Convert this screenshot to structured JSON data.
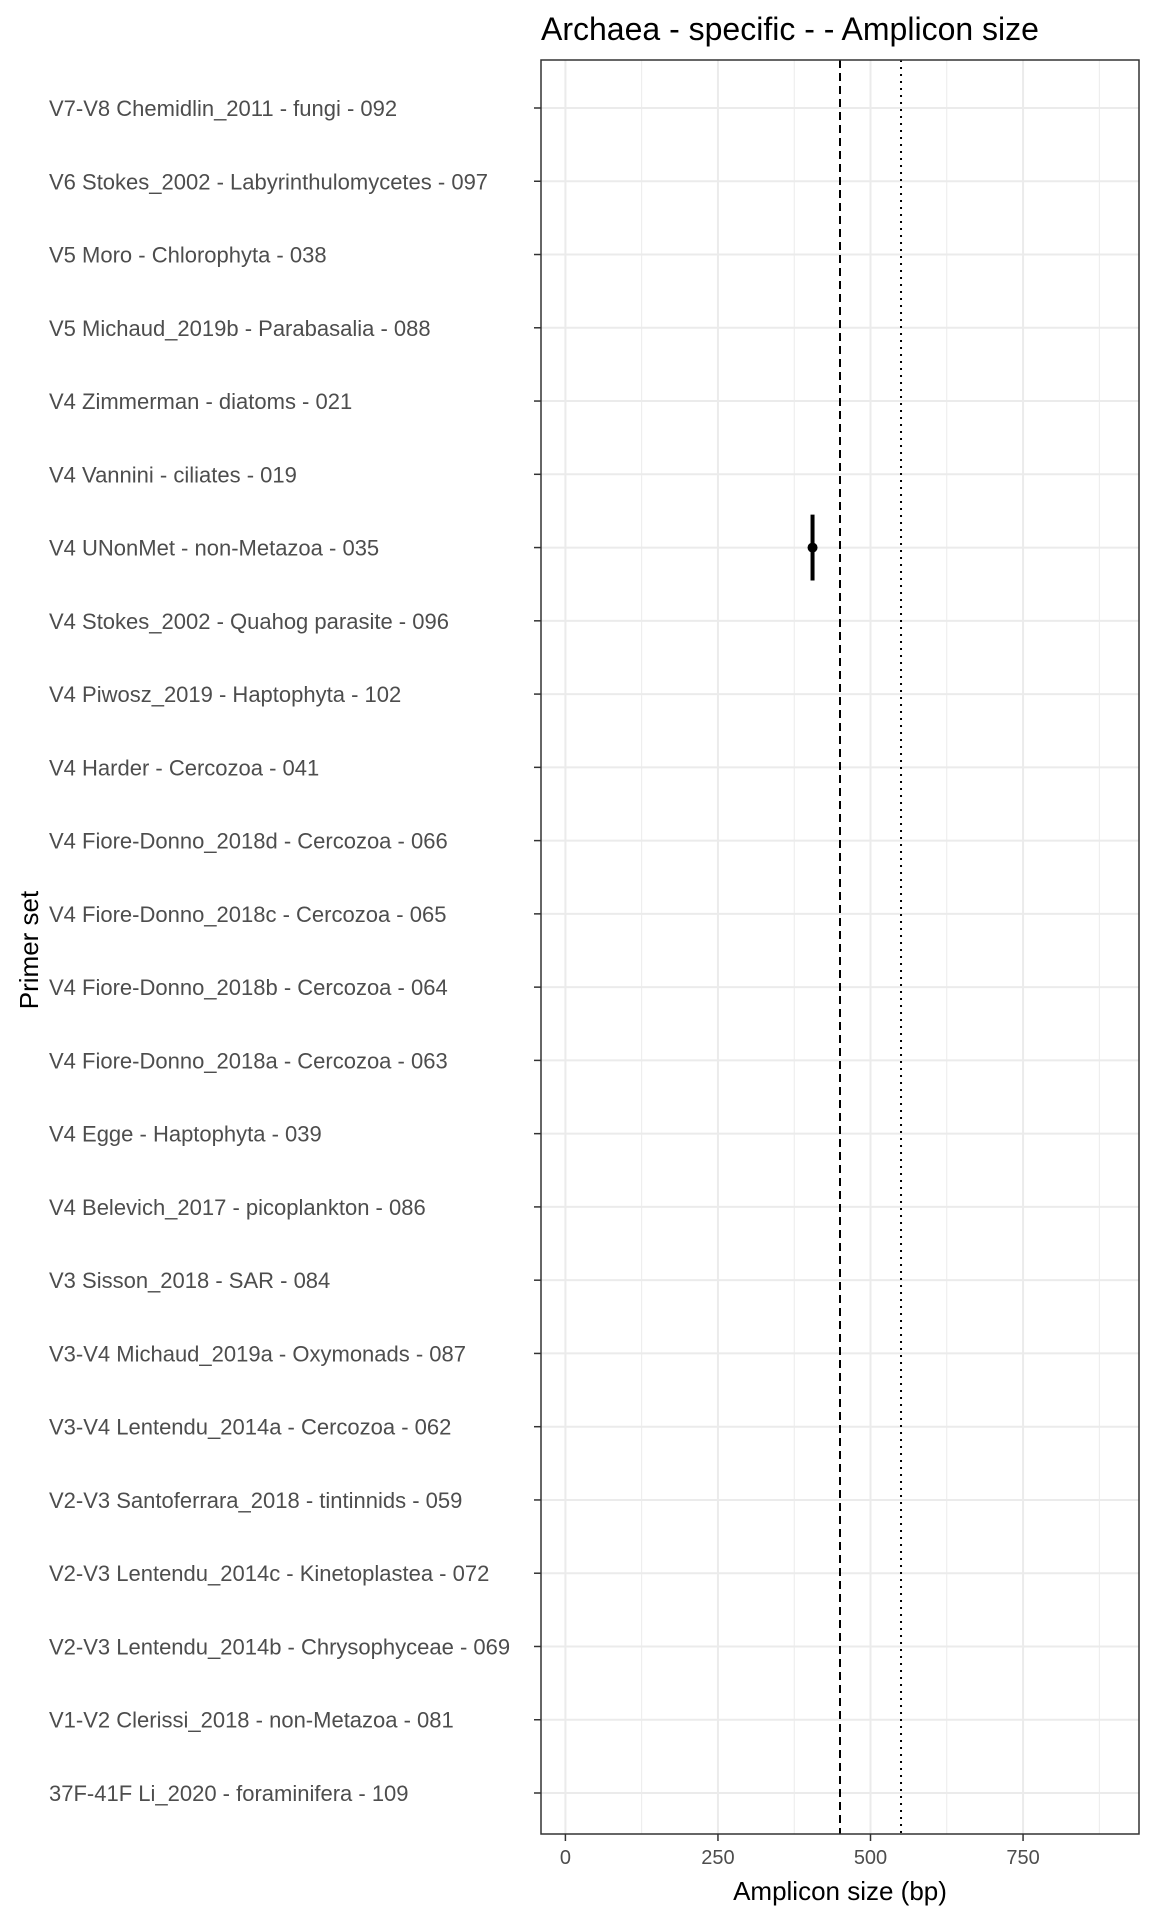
{
  "chart_data": {
    "type": "scatter",
    "title": "Archaea - specific -  - Amplicon size",
    "xlabel": "Amplicon size (bp)",
    "ylabel": "Primer set",
    "xlim": [
      -40,
      940
    ],
    "xticks": [
      0,
      250,
      500,
      750
    ],
    "grid": true,
    "legend": "none",
    "categories": [
      "37F-41F Li_2020 - foraminifera - 109",
      "V1-V2 Clerissi_2018 - non-Metazoa - 081",
      "V2-V3 Lentendu_2014b - Chrysophyceae - 069",
      "V2-V3 Lentendu_2014c - Kinetoplastea - 072",
      "V2-V3 Santoferrara_2018 - tintinnids - 059",
      "V3-V4 Lentendu_2014a - Cercozoa - 062",
      "V3-V4 Michaud_2019a - Oxymonads - 087",
      "V3 Sisson_2018 - SAR - 084",
      "V4 Belevich_2017 - picoplankton - 086",
      "V4 Egge - Haptophyta - 039",
      "V4 Fiore-Donno_2018a - Cercozoa - 063",
      "V4 Fiore-Donno_2018b - Cercozoa - 064",
      "V4 Fiore-Donno_2018c - Cercozoa - 065",
      "V4 Fiore-Donno_2018d - Cercozoa - 066",
      "V4 Harder - Cercozoa - 041",
      "V4 Piwosz_2019 - Haptophyta - 102",
      "V4 Stokes_2002 - Quahog parasite - 096",
      "V4 UNonMet - non-Metazoa - 035",
      "V4 Vannini - ciliates - 019",
      "V4 Zimmerman - diatoms - 021",
      "V5 Michaud_2019b - Parabasalia - 088",
      "V5 Moro - Chlorophyta - 038",
      "V6 Stokes_2002 - Labyrinthulomycetes - 097",
      "V7-V8 Chemidlin_2011 - fungi - 092"
    ],
    "points": [
      {
        "category": "V4 UNonMet - non-Metazoa - 035",
        "x": 405,
        "xmin": 405,
        "xmax": 405,
        "ymin_offset": -0.45,
        "ymax_offset": 0.45
      }
    ],
    "reference_lines": [
      {
        "x": 450,
        "style": "dashed"
      },
      {
        "x": 550,
        "style": "dotted"
      }
    ],
    "colors": {
      "point": "#000000",
      "grid": "#ebebeb",
      "panel_border": "#333333",
      "label": "#4d4d4d"
    }
  }
}
